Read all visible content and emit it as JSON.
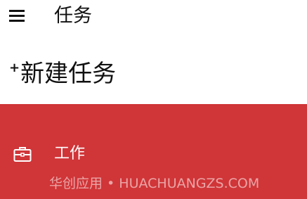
{
  "header": {
    "menu_icon": "hamburger-menu-icon",
    "title": "任务"
  },
  "new_task": {
    "plus": "+",
    "label": "新建任务"
  },
  "list": {
    "accent_color": "#d03538",
    "items": [
      {
        "icon": "briefcase-icon",
        "label": "工作"
      }
    ]
  },
  "watermark": "华创应用 • HUACHUANGZS.COM"
}
